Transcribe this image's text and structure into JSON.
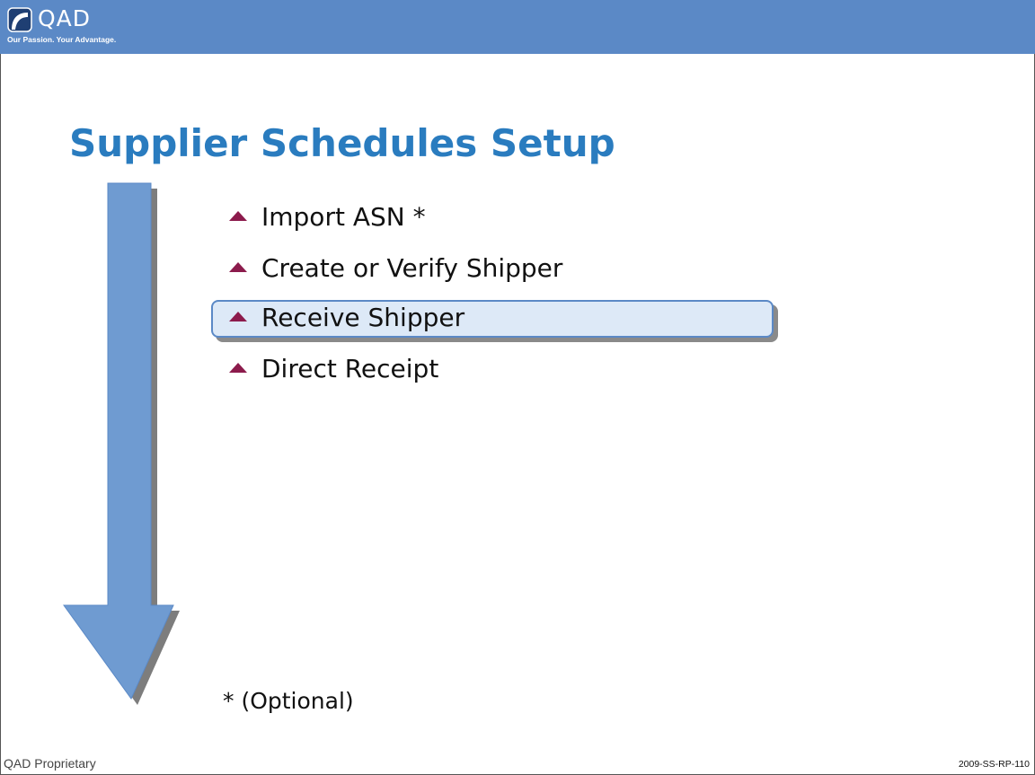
{
  "header": {
    "logo_text": "QAD",
    "tagline": "Our Passion. Your Advantage.",
    "bar_color": "#5b89c6"
  },
  "slide": {
    "title": "Supplier Schedules Setup",
    "bullets": [
      {
        "label": "Import ASN *",
        "highlighted": false
      },
      {
        "label": "Create or Verify Shipper",
        "highlighted": false
      },
      {
        "label": "Receive Shipper",
        "highlighted": true
      },
      {
        "label": "Direct Receipt",
        "highlighted": false
      }
    ],
    "footnote": "* (Optional)",
    "flow_arrow_icon": "down-arrow-icon"
  },
  "footer": {
    "left": "QAD Proprietary",
    "right": "2009-SS-RP-110"
  },
  "colors": {
    "title": "#2a7cbf",
    "bullet_marker": "#8c1b4c",
    "highlight_fill": "#dde9f7",
    "arrow_fill": "#5b89c6"
  }
}
